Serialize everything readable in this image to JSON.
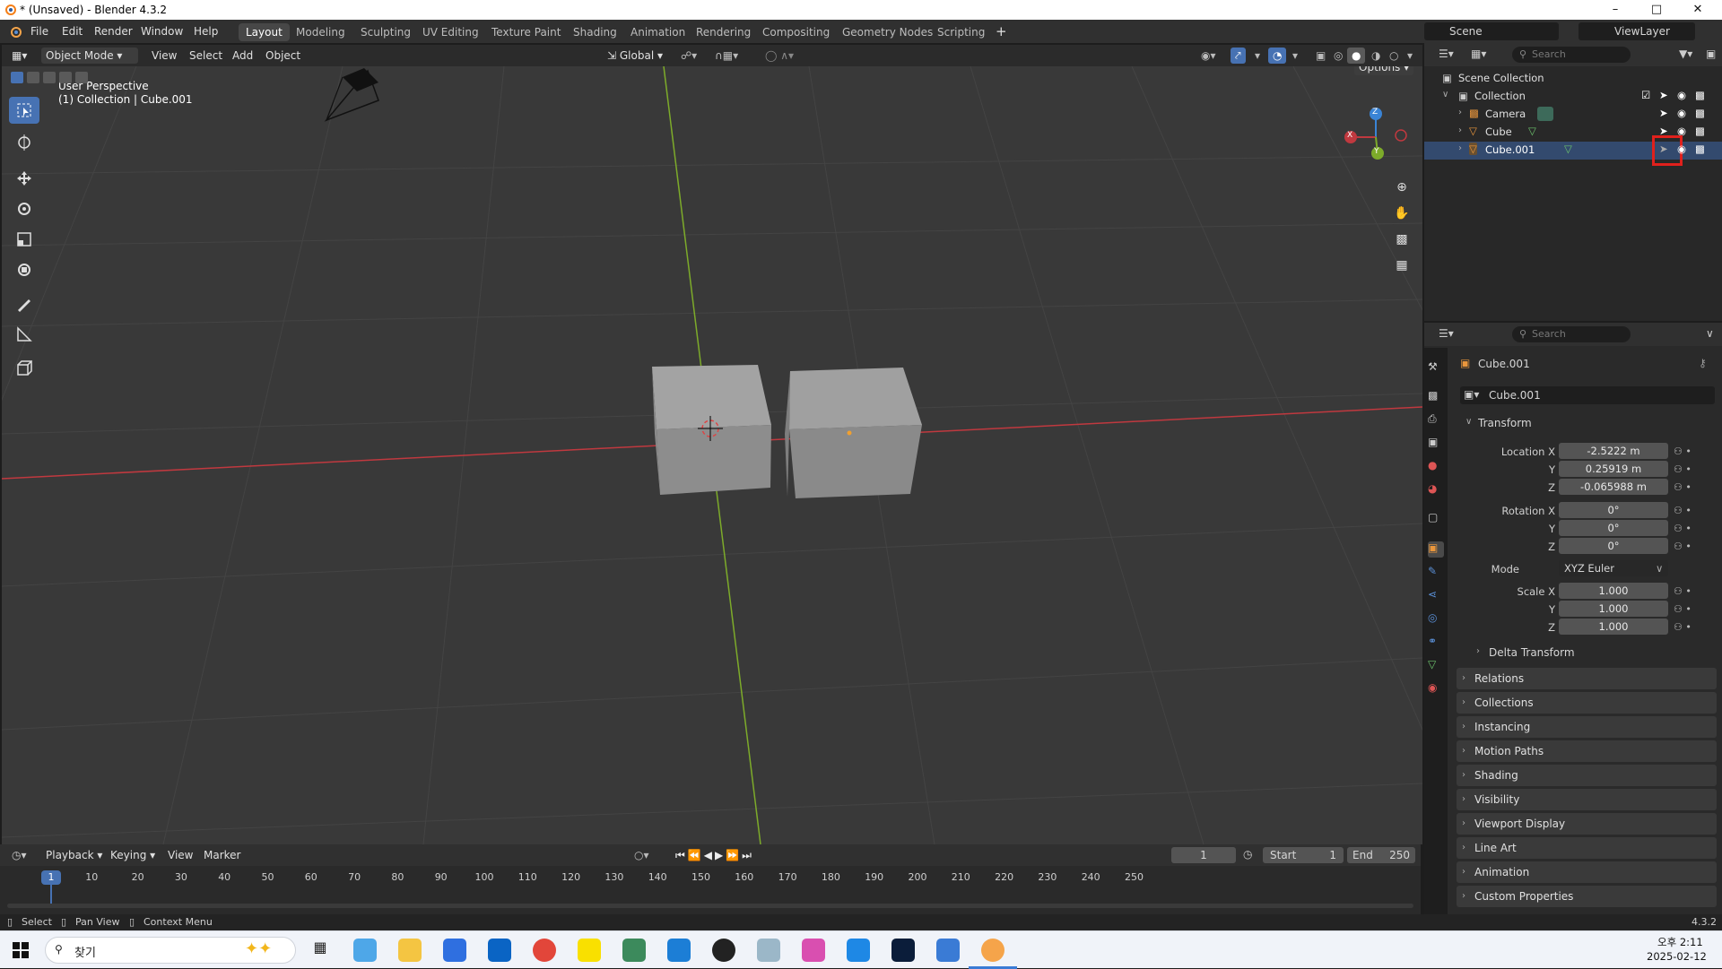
{
  "window": {
    "title": "* (Unsaved) - Blender 4.3.2",
    "min": "–",
    "max": "□",
    "close": "✕"
  },
  "menubar": {
    "menus": [
      "File",
      "Edit",
      "Render",
      "Window",
      "Help"
    ],
    "workspaces": [
      "Layout",
      "Modeling",
      "Sculpting",
      "UV Editing",
      "Texture Paint",
      "Shading",
      "Animation",
      "Rendering",
      "Compositing",
      "Geometry Nodes",
      "Scripting"
    ],
    "add_tab": "+",
    "scene": "Scene",
    "view_layer": "ViewLayer"
  },
  "viewport_header": {
    "mode": "Object Mode",
    "menus": [
      "View",
      "Select",
      "Add",
      "Object"
    ],
    "orientation": "Global",
    "options": "Options"
  },
  "viewport": {
    "perspective": "User Perspective",
    "collection_label": "(1) Collection | Cube.001",
    "gizmo": {
      "z": "Z",
      "x": "X",
      "y": "Y"
    }
  },
  "outliner": {
    "search_placeholder": "Search",
    "scene_collection": "Scene Collection",
    "rows": [
      "Collection",
      "Camera",
      "Cube",
      "Cube.001"
    ]
  },
  "properties": {
    "search_placeholder": "Search",
    "object_name": "Cube.001",
    "datablock": "Cube.001",
    "transform_label": "Transform",
    "location_label": "Location X",
    "rotation_label": "Rotation X",
    "scale_label": "Scale X",
    "y": "Y",
    "z": "Z",
    "location": [
      "-2.5222 m",
      "0.25919 m",
      "-0.065988 m"
    ],
    "rotation": [
      "0°",
      "0°",
      "0°"
    ],
    "mode_label": "Mode",
    "mode_value": "XYZ Euler",
    "scale": [
      "1.000",
      "1.000",
      "1.000"
    ],
    "delta": "Delta Transform",
    "panels": [
      "Relations",
      "Collections",
      "Instancing",
      "Motion Paths",
      "Shading",
      "Visibility",
      "Viewport Display",
      "Line Art",
      "Animation",
      "Custom Properties"
    ]
  },
  "timeline": {
    "menus": [
      "Playback",
      "Keying",
      "View",
      "Marker"
    ],
    "current_frame": "1",
    "start_label": "Start",
    "start": "1",
    "end_label": "End",
    "end": "250",
    "ticks": [
      "1",
      "10",
      "20",
      "30",
      "40",
      "50",
      "60",
      "70",
      "80",
      "90",
      "100",
      "110",
      "120",
      "130",
      "140",
      "150",
      "160",
      "170",
      "180",
      "190",
      "200",
      "210",
      "220",
      "230",
      "240",
      "250"
    ]
  },
  "statusbar": {
    "select": "Select",
    "pan": "Pan View",
    "context": "Context Menu",
    "version": "4.3.2"
  },
  "taskbar": {
    "search": "찾기",
    "time": "오후 2:11",
    "date": "2025-02-12"
  },
  "colors": {
    "accent": "#4772b3",
    "x_axis": "#c0393f",
    "y_axis": "#7dab2a",
    "z_axis": "#3a84d6",
    "highlight_box": "#e0201c"
  }
}
